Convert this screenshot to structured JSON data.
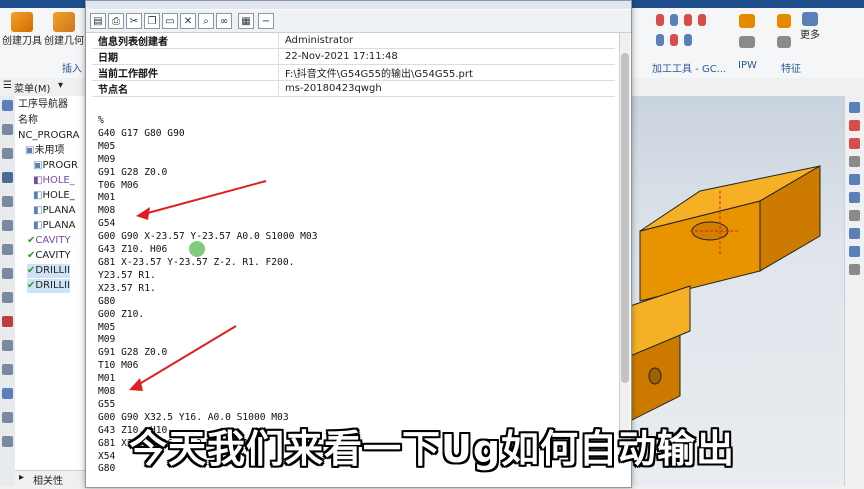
{
  "ribbon": {
    "btn_create_tool": "创建刀具",
    "btn_create_geometry": "创建几何",
    "label_insert": "插入",
    "label_machining_tools": "加工工具 - GC...",
    "label_ipw": "IPW",
    "label_feature": "特征",
    "label_more": "更多"
  },
  "menubar": {
    "menu": "菜单(M)"
  },
  "navigator": {
    "title": "工序导航器",
    "col_name": "名称",
    "root": "NC_PROGRA",
    "items": [
      "未用项",
      "PROGR",
      "HOLE_",
      "HOLE_",
      "PLANA",
      "PLANA",
      "CAVITY",
      "CAVITY",
      "DRILLII",
      "DRILLII"
    ]
  },
  "bottom_panel": {
    "label": "相关性"
  },
  "info_window": {
    "rows": [
      {
        "key": "信息列表创建者",
        "value": "Administrator"
      },
      {
        "key": "日期",
        "value": "22-Nov-2021 17:11:48"
      },
      {
        "key": "当前工作部件",
        "value": "F:\\抖音文件\\G54G55的输出\\G54G55.prt"
      },
      {
        "key": "节点名",
        "value": "ms-20180423qwgh"
      }
    ],
    "code_lines": [
      "%",
      "G40 G17 G80 G90",
      "M05",
      "M09",
      "G91 G28 Z0.0",
      "T06 M06",
      "M01",
      "M08",
      "G54",
      "G00 G90 X-23.57 Y-23.57 A0.0 S1000 M03",
      "G43 Z10. H06",
      "G81 X-23.57 Y-23.57 Z-2. R1. F200.",
      "Y23.57 R1.",
      "X23.57 R1.",
      "G80",
      "G00 Z10.",
      "M05",
      "M09",
      "G91 G28 Z0.0",
      "T10 M06",
      "M01",
      "M08",
      "G55",
      "G00 G90 X32.5 Y16. A0.0 S1000 M03",
      "G43 Z10. H10",
      "G81 X32.5 Y16. Z-2. R1. F200.",
      "X54",
      "G80"
    ]
  },
  "caption": "今天我们来看一下Ug如何自动输出",
  "colors": {
    "arrow": "#e02020",
    "part": "#f0a000",
    "accent": "#1f4e8c"
  },
  "icons": [
    "new-icon",
    "print-icon",
    "cut-icon",
    "copy-icon",
    "paste-icon",
    "close-icon",
    "find-icon",
    "binoculars-icon",
    "save-icon",
    "minimize-icon"
  ]
}
